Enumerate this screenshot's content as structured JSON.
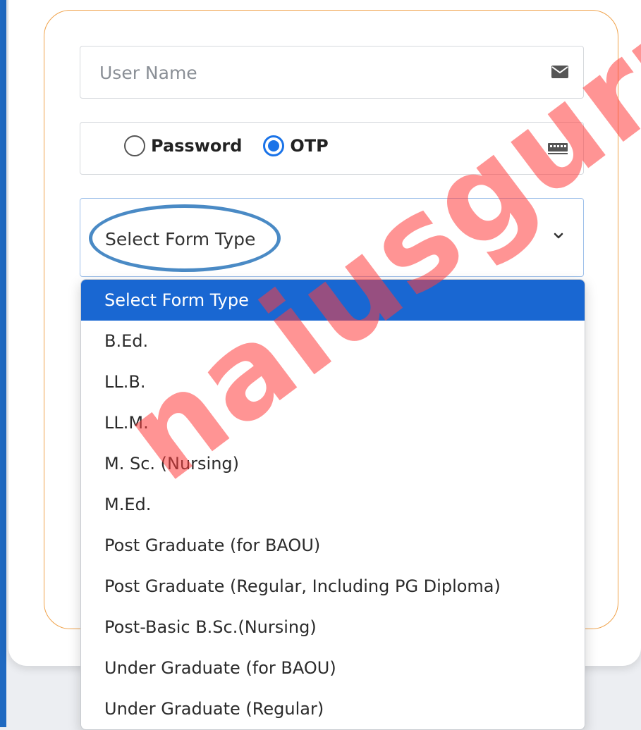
{
  "login": {
    "username_placeholder": "User Name",
    "auth_options": [
      {
        "label": "Password",
        "checked": false
      },
      {
        "label": "OTP",
        "checked": true
      }
    ],
    "form_type_selected": "Select Form Type"
  },
  "dropdown": {
    "options": [
      "Select Form Type",
      "B.Ed.",
      "LL.B.",
      "LL.M.",
      "M. Sc. (Nursing)",
      "M.Ed.",
      "Post Graduate (for BAOU)",
      "Post Graduate (Regular, Including PG Diploma)",
      "Post-Basic B.Sc.(Nursing)",
      "Under Graduate (for BAOU)",
      "Under Graduate (Regular)"
    ],
    "highlighted_index": 0
  },
  "watermark": {
    "text": "naiusguru"
  },
  "colors": {
    "accent": "#1967d2",
    "form_border": "#f0a24a",
    "annotation": "#4a8ac5",
    "watermark": "#ff3c3c"
  }
}
